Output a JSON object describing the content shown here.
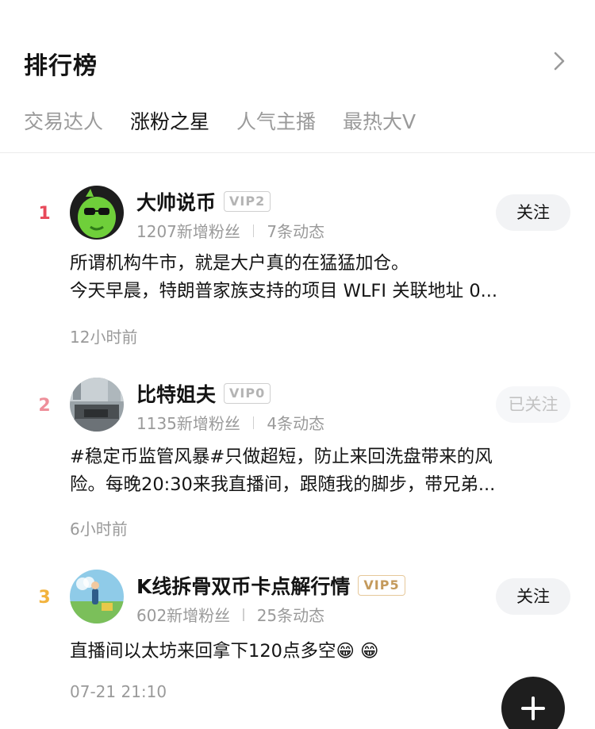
{
  "header": {
    "title": "排行榜",
    "chevron_icon": "chevron-right-icon"
  },
  "tabs": [
    {
      "label": "交易达人",
      "active": false
    },
    {
      "label": "涨粉之星",
      "active": true
    },
    {
      "label": "人气主播",
      "active": false
    },
    {
      "label": "最热大V",
      "active": false
    }
  ],
  "colors": {
    "rank_1": "#e8495a",
    "rank_2": "#ee8f9a",
    "rank_3": "#f2b33d",
    "fab_bg": "#1e1e1e"
  },
  "items": [
    {
      "rank": "1",
      "name": "大帅说币",
      "vip": "VIP2",
      "new_fans": "1207新增粉丝",
      "posts": "7条动态",
      "follow_label": "关注",
      "content_lines": [
        "所谓机构牛市，就是大户真的在猛猛加仓。",
        "今天早晨，特朗普家族支持的项目 WLFI 关联地址 0..."
      ],
      "time": "12小时前"
    },
    {
      "rank": "2",
      "name": "比特姐夫",
      "vip": "VIP0",
      "new_fans": "1135新增粉丝",
      "posts": "4条动态",
      "follow_label": "已关注",
      "content_lines": [
        "#稳定币监管风暴#只做超短，防止来回洗盘带来的风",
        "险。每晚20:30来我直播间，跟随我的脚步，带兄弟..."
      ],
      "time": "6小时前"
    },
    {
      "rank": "3",
      "name": "K线拆骨双币卡点解行情",
      "vip": "VIP5",
      "new_fans": "602新增粉丝",
      "posts": "25条动态",
      "follow_label": "关注",
      "content_lines": [
        "直播间以太坊来回拿下120点多空😁 😁"
      ],
      "time": "07-21 21:10"
    }
  ],
  "fab": {
    "icon": "plus-icon"
  }
}
